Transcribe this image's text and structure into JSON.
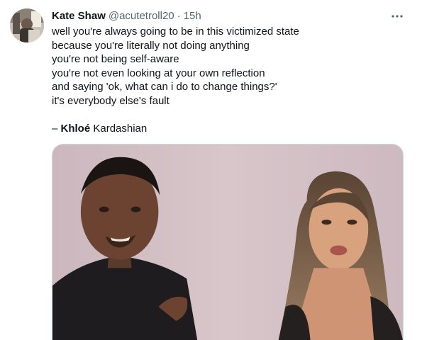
{
  "tweet": {
    "author_name": "Kate Shaw",
    "author_handle": "@acutetroll20",
    "separator": "·",
    "timestamp": "15h",
    "more_icon": "more-horizontal-icon",
    "text_lines": [
      "well you're always going to be in this victimized state",
      "because you're literally not doing anything",
      "you're not being self-aware",
      "you're not even looking at your own reflection",
      "and saying 'ok, what can i do to change things?'",
      "it's everybody else's fault"
    ],
    "attribution_dash": "– ",
    "attribution_bold": "Khloé",
    "attribution_rest": " Kardashian"
  },
  "colors": {
    "text_primary": "#0f1419",
    "text_secondary": "#536471",
    "border": "#cfd9de"
  }
}
